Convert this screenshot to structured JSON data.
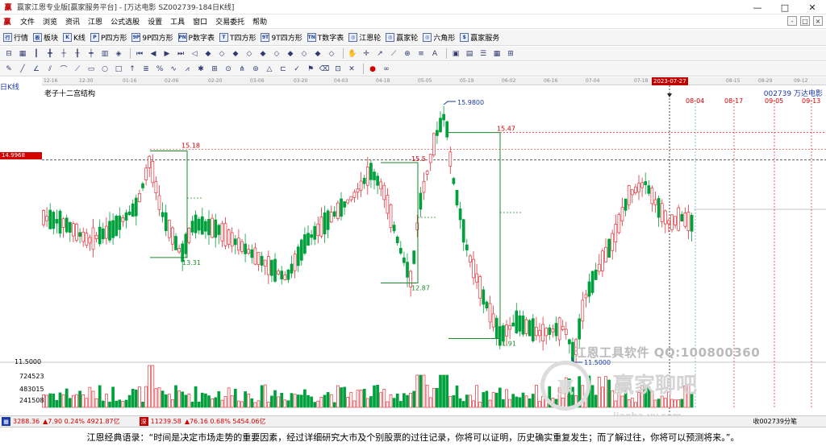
{
  "window": {
    "title": "赢家江恩专业版[赢家服务平台] - [万达电影  SZ002739-184日K线]",
    "controls": [
      "—",
      "□",
      "✕"
    ]
  },
  "menu": {
    "items": [
      "文件",
      "浏览",
      "资讯",
      "江恩",
      "公式选股",
      "设置",
      "工具",
      "窗口",
      "交易委托",
      "帮助"
    ],
    "right_buttons": [
      "-",
      "□",
      "×"
    ]
  },
  "toolbar1": {
    "items": [
      {
        "icon": "行",
        "label": "行情"
      },
      {
        "icon": "板",
        "label": "板块"
      },
      {
        "icon": "K",
        "label": "K线"
      },
      {
        "icon": "P",
        "label": "P四方形"
      },
      {
        "icon": "9P",
        "label": "9P四方形"
      },
      {
        "icon": "PN",
        "label": "P数字表"
      },
      {
        "icon": "T",
        "label": "T四方形"
      },
      {
        "icon": "9T",
        "label": "9T四方形"
      },
      {
        "icon": "TN",
        "label": "T数字表"
      },
      {
        "icon": "◎",
        "label": "江恩轮"
      },
      {
        "icon": "◎",
        "label": "赢家轮"
      },
      {
        "icon": "◎",
        "label": "六角形"
      },
      {
        "icon": "$",
        "label": "赢家服务"
      }
    ]
  },
  "timeline": {
    "labels": [
      "12-16",
      "12-30",
      "01-16",
      "02-06",
      "02-20",
      "03-06",
      "03-20",
      "04-03",
      "04-18",
      "05-05",
      "05-19",
      "06-02",
      "06-16",
      "07-04",
      "07-18",
      "08-15",
      "08-29",
      "09-12"
    ],
    "highlight": "2023-07-27"
  },
  "chart": {
    "period_label": "日K线",
    "subtitle": "老子十二宫结构",
    "stock_id": "002739  万达电影",
    "current_price_tag": "14.9968",
    "colors": {
      "up": "#e0323a",
      "down": "#00a03c",
      "box": "#1a8a2a",
      "annotation_blue": "#1c3aa8",
      "date_line": "#d40000"
    },
    "annotations": {
      "high_1518": "15.18",
      "high_1547": "15.47",
      "high_15x": "15.5",
      "peak_1598": "15.9800",
      "low_1331": "13.31",
      "low_1287": "12.87",
      "low_1191": "11.91",
      "low_1150": "11.5000"
    },
    "future_dates": [
      "08-04",
      "08-17",
      "09-05",
      "09-13"
    ],
    "volume_axis": [
      "11.5000",
      "724523",
      "483015",
      "241508"
    ]
  },
  "watermark": {
    "software": "江恩工具软件  QQ:100800360",
    "brand": "赢家聊吧",
    "site": "jiaoba.yy.com",
    "circle": "赢"
  },
  "statusbar": {
    "idx1_value": "3288.36",
    "idx1_change": "▲7.90 0.24% 4921.87亿",
    "idx2_value": "11239.58",
    "idx2_change": "▲76.16 0.68% 5454.06亿",
    "right_text": "收002739分笔"
  },
  "quote": "江恩经典语录：“时间是决定市场走势的重要因素，经过详细研究大市及个别股票的过往记录，你将可以证明，历史确实重复发生；而了解过往，你将可以预测将来。”。"
}
